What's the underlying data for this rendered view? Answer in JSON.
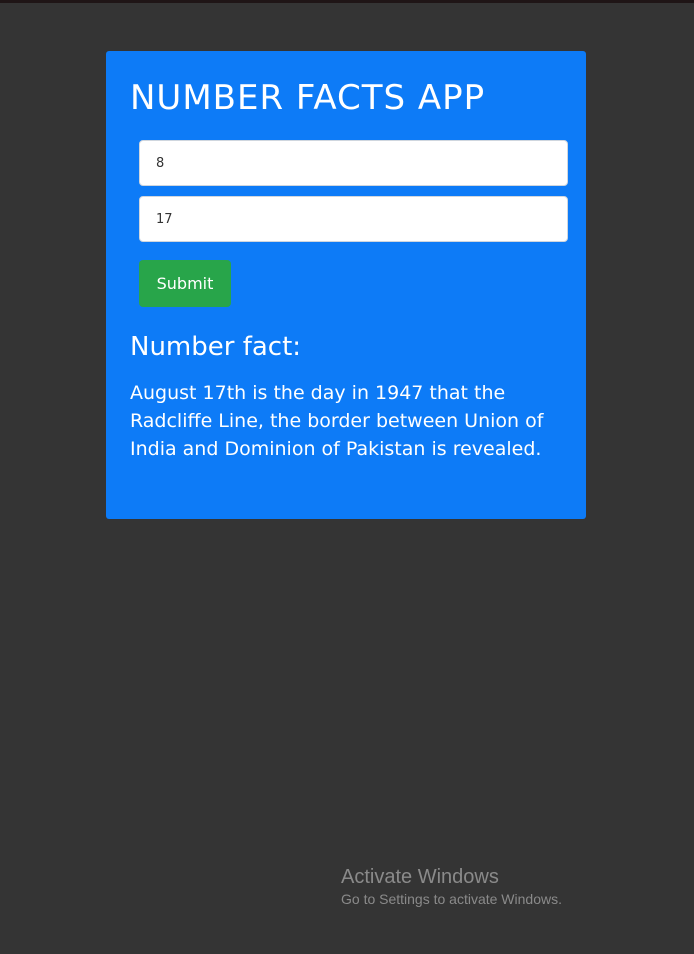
{
  "app": {
    "title": "NUMBER FACTS APP"
  },
  "form": {
    "first_value": "8",
    "second_value": "17",
    "submit_label": "Submit"
  },
  "result": {
    "heading": "Number fact:",
    "text": "August 17th is the day in 1947 that the Radcliffe Line, the border between Union of India and Dominion of Pakistan is revealed."
  },
  "watermark": {
    "title": "Activate Windows",
    "subtitle": "Go to Settings to activate Windows."
  },
  "colors": {
    "page_background": "#343434",
    "card_background": "#0d7bf7",
    "submit_button": "#28a54a",
    "text_on_card": "#ffffff"
  }
}
